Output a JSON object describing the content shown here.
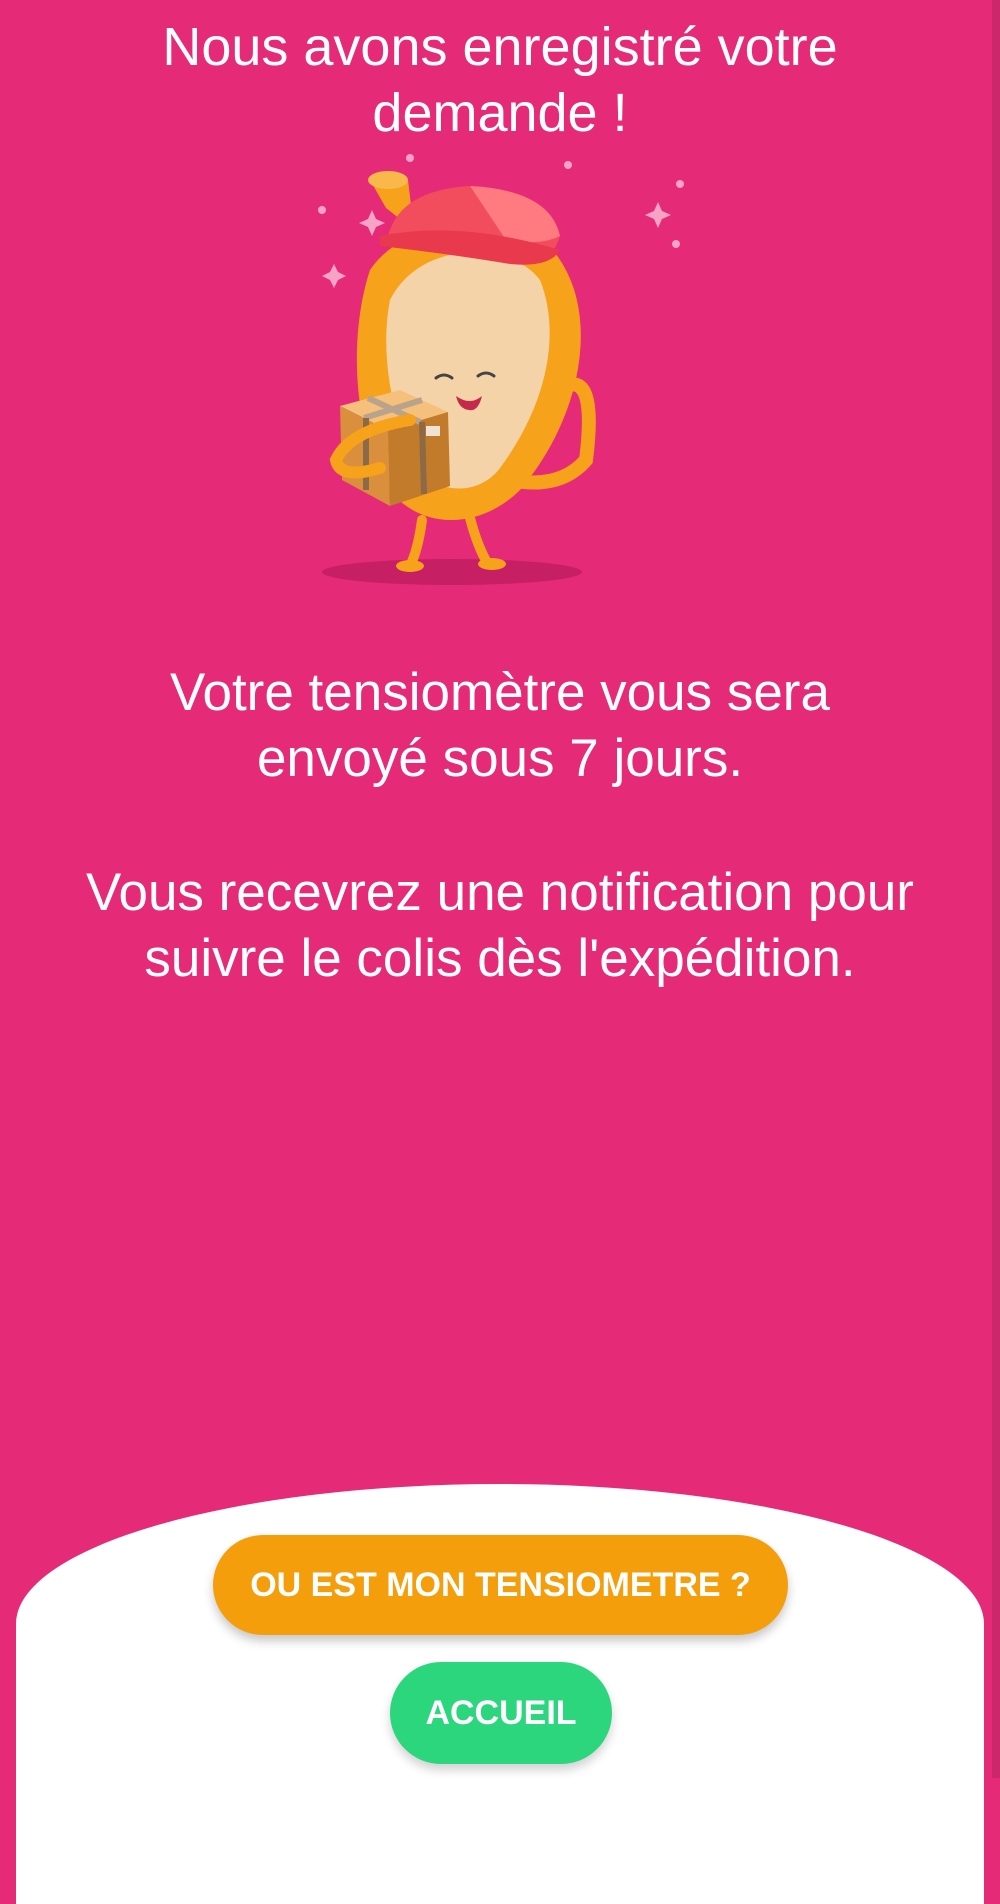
{
  "confirmation": {
    "title_line1": "Nous avons enregistré votre",
    "title_line2": "demande !",
    "message1_line1": "Votre tensiomètre vous sera",
    "message1_line2": "envoyé sous 7 jours.",
    "message2_line1": "Vous recevrez une notification pour",
    "message2_line2": "suivre le colis dès l'expédition."
  },
  "illustration": {
    "icon": "mascot-with-package-icon"
  },
  "actions": {
    "track_label": "OU EST MON TENSIOMETRE ?",
    "home_label": "ACCUEIL"
  },
  "colors": {
    "background": "#e52a77",
    "primary_button": "#f59e0b",
    "secondary_button": "#2bd67d",
    "sheet": "#ffffff"
  }
}
